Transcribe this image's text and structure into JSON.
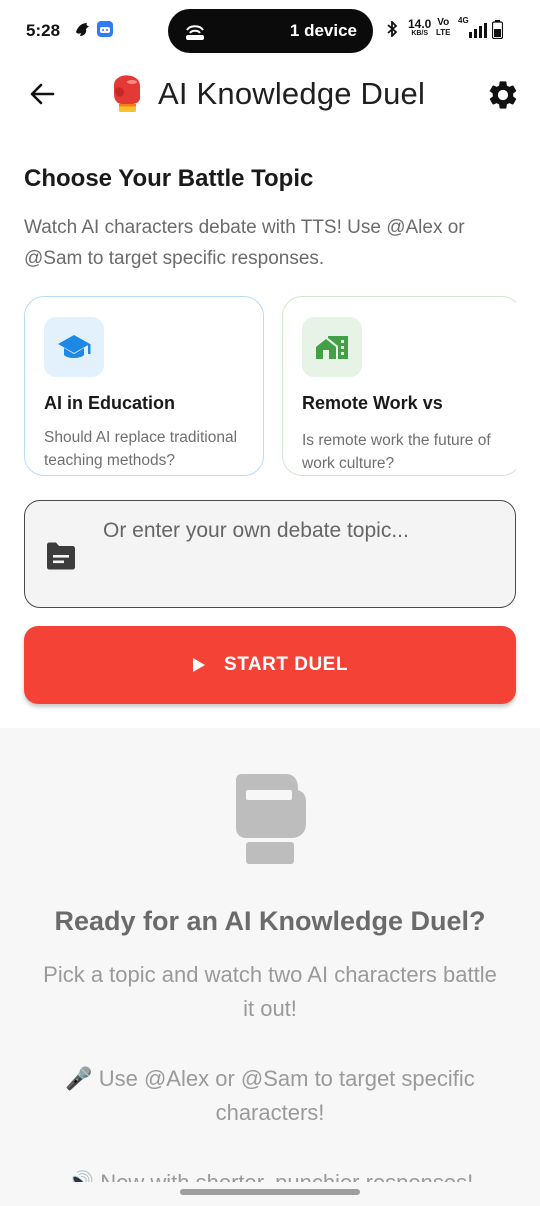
{
  "status_bar": {
    "time": "5:28",
    "hotspot": "1 device",
    "net_speed_value": "14.0",
    "net_speed_unit": "KB/S",
    "volte_top": "Vo",
    "volte_bottom": "LTE",
    "signal_label": "4G"
  },
  "app_bar": {
    "title_emoji_name": "boxing-glove-emoji",
    "title": "AI Knowledge Duel"
  },
  "topic_section": {
    "heading": "Choose Your Battle Topic",
    "description": "Watch AI characters debate with TTS! Use @Alex or @Sam to target specific responses."
  },
  "topic_cards": [
    {
      "icon": "graduation-cap-icon",
      "title": "AI in Education",
      "subtitle": "Should AI replace traditional teaching methods?",
      "accent": "#1e88e5",
      "border": "#b9dcf4"
    },
    {
      "icon": "home-work-icon",
      "title": "Remote Work vs",
      "subtitle": "Is remote work the future of work culture?",
      "accent": "#43a047",
      "border": "#cfe8cf"
    }
  ],
  "custom_topic": {
    "placeholder": "Or enter your own debate topic...",
    "value": ""
  },
  "start_button": {
    "label": "START DUEL",
    "color": "#f44336"
  },
  "empty_state": {
    "title": "Ready for an AI Knowledge Duel?",
    "description": "Pick a topic and watch two AI characters battle it out!",
    "tip": "🎤 Use @Alex or @Sam to target specific characters!",
    "tip2": "🔊 Now with shorter, punchier responses!"
  }
}
